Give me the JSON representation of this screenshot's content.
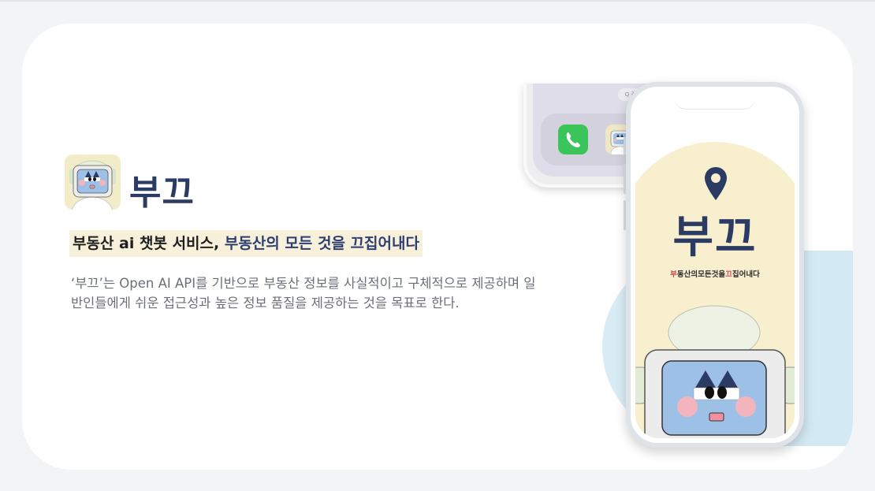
{
  "brand": {
    "name": "부끄",
    "primary_color": "#2c3b64",
    "accent_color": "#d24b5c",
    "highlight_bg": "#f7f1dc"
  },
  "headline": {
    "part1": "부동산 ai 챗봇 서비스, ",
    "part2": "부동산의 모든 것을 끄집어내다"
  },
  "description": "‘부끄’는 Open AI API를 기반으로 부동산 정보를 사실적이고 구체적으로 제공하며 일반인들에게 쉬운 접근성과 높은 정보 품질을 제공하는 것을 목표로 한다.",
  "back_phone": {
    "search_label": "Q 검색",
    "dock_icons": [
      "phone-app-icon",
      "bugge-app-icon",
      "safari-app-icon"
    ]
  },
  "front_phone": {
    "title": "부끄",
    "slogan_parts": [
      "부",
      "동산의모든것을",
      "끄",
      "집어내다"
    ]
  }
}
